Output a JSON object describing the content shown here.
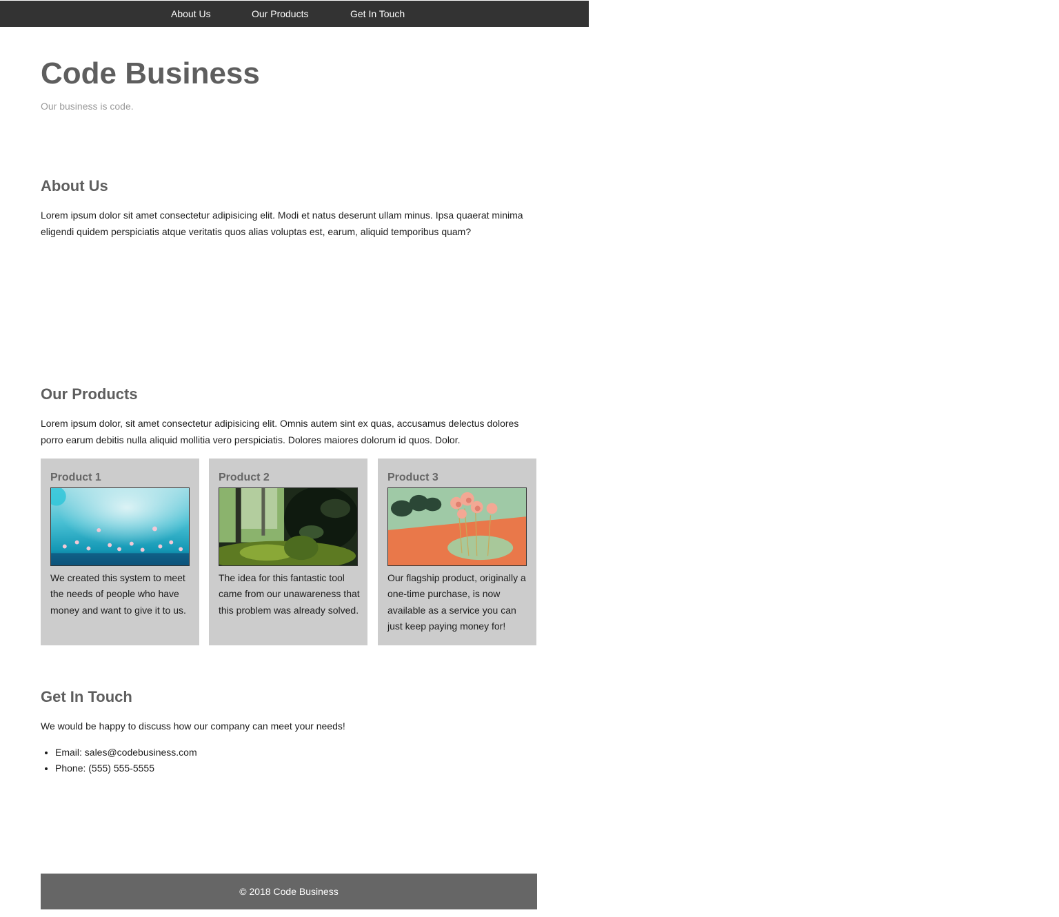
{
  "nav": {
    "items": [
      {
        "label": "About Us"
      },
      {
        "label": "Our Products"
      },
      {
        "label": "Get In Touch"
      }
    ]
  },
  "header": {
    "title": "Code Business",
    "tagline": "Our business is code."
  },
  "about": {
    "heading": "About Us",
    "text": "Lorem ipsum dolor sit amet consectetur adipisicing elit. Modi et natus deserunt ullam minus. Ipsa quaerat minima eligendi quidem perspiciatis atque veritatis quos alias voluptas est, earum, aliquid temporibus quam?"
  },
  "products": {
    "heading": "Our Products",
    "text": "Lorem ipsum dolor, sit amet consectetur adipisicing elit. Omnis autem sint ex quas, accusamus delectus dolores porro earum debitis nulla aliquid mollitia vero perspiciatis. Dolores maiores dolorum id quos. Dolor.",
    "items": [
      {
        "title": "Product 1",
        "description": "We created this system to meet the needs of people who have money and want to give it to us."
      },
      {
        "title": "Product 2",
        "description": "The idea for this fantastic tool came from our unawareness that this problem was already solved."
      },
      {
        "title": "Product 3",
        "description": "Our flagship product, originally a one-time purchase, is now available as a service you can just keep paying money for!"
      }
    ]
  },
  "contact": {
    "heading": "Get In Touch",
    "text": "We would be happy to discuss how our company can meet your needs!",
    "items": [
      {
        "label": "Email: sales@codebusiness.com"
      },
      {
        "label": "Phone: (555) 555-5555"
      }
    ]
  },
  "footer": {
    "text": "© 2018 Code Business"
  },
  "colors": {
    "nav_bg": "#333333",
    "heading": "#5e5e5e",
    "card_bg": "#cccccc",
    "footer_bg": "#666666"
  }
}
